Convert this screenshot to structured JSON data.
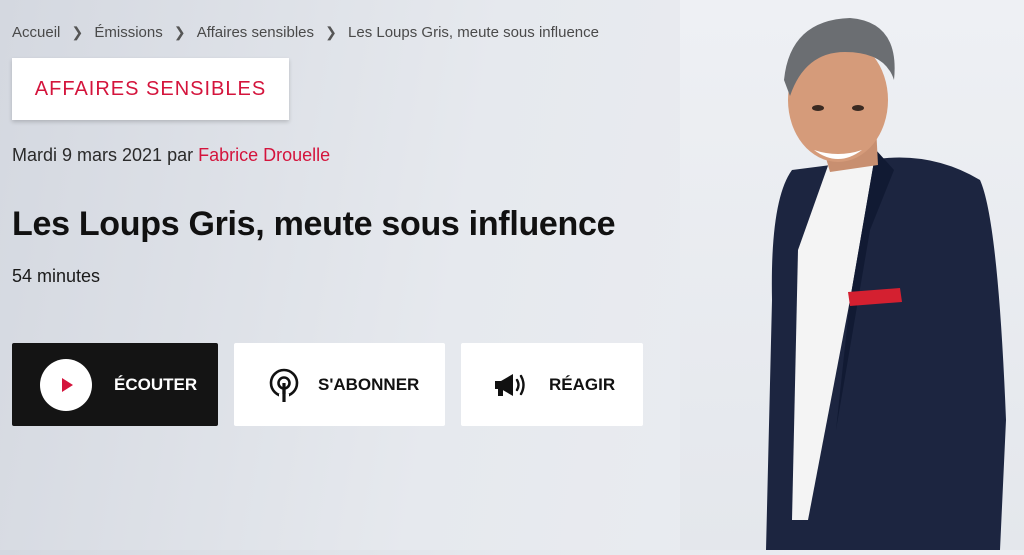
{
  "breadcrumb": {
    "items": [
      "Accueil",
      "Émissions",
      "Affaires sensibles",
      "Les Loups Gris, meute sous influence"
    ],
    "separator": ">"
  },
  "show": {
    "name": "AFFAIRES SENSIBLES"
  },
  "episode": {
    "date": "Mardi 9 mars 2021",
    "by": "par",
    "author": "Fabrice Drouelle",
    "title": "Les Loups Gris, meute sous influence",
    "duration": "54 minutes"
  },
  "actions": {
    "listen": "ÉCOUTER",
    "subscribe": "S'ABONNER",
    "react": "RÉAGIR"
  },
  "colors": {
    "accent": "#d4143c",
    "dark": "#141414"
  },
  "icons": {
    "listen": "play-icon",
    "subscribe": "podcast-icon",
    "react": "megaphone-icon"
  }
}
